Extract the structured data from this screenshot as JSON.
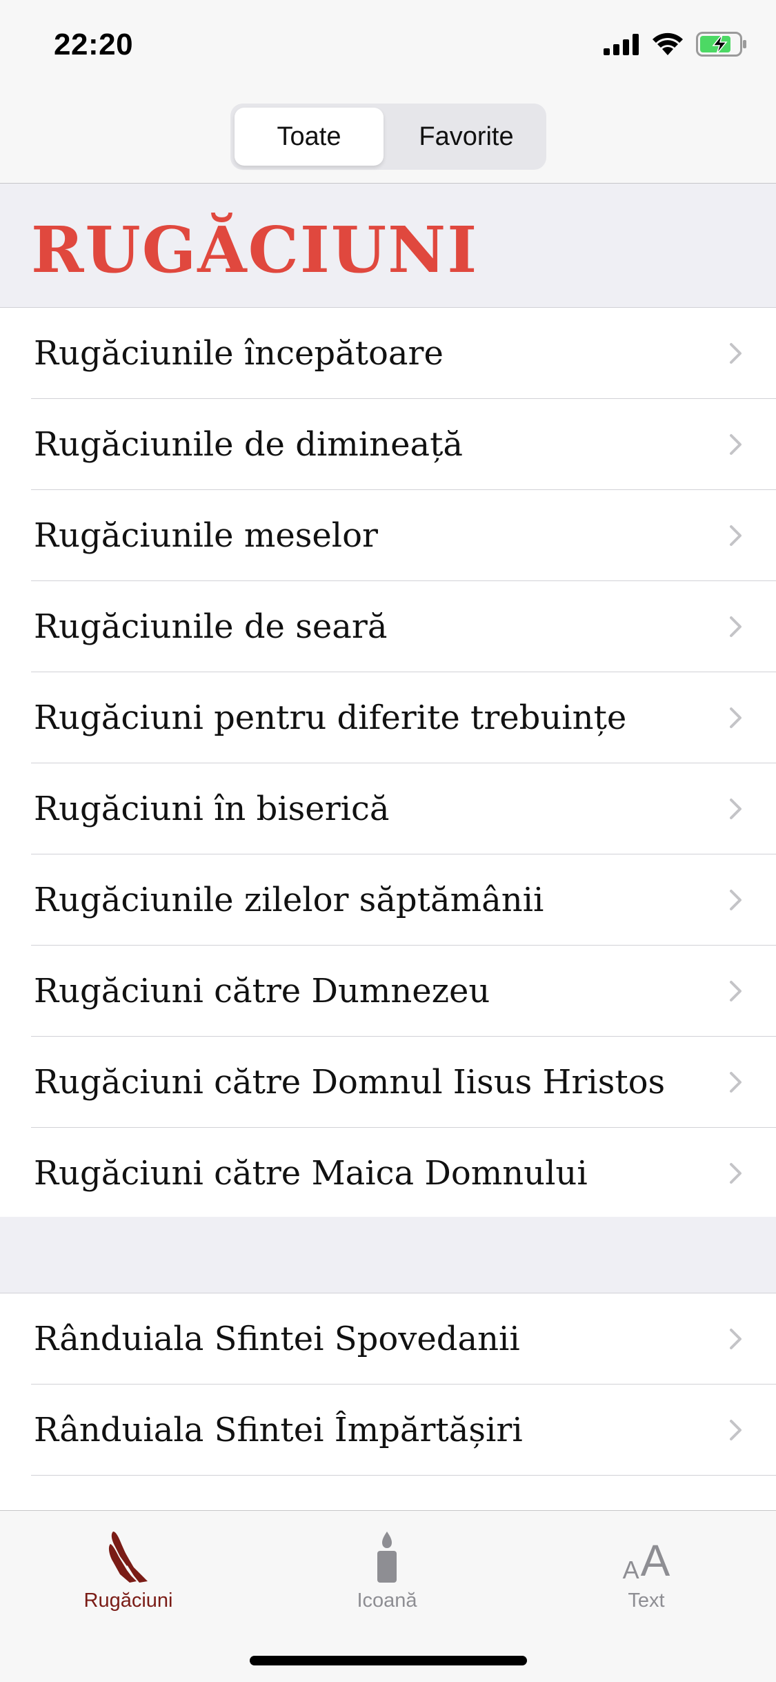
{
  "status_bar": {
    "time": "22:20",
    "icons": [
      "cellular-signal-icon",
      "wifi-icon",
      "battery-charging-icon"
    ]
  },
  "segmented_control": {
    "options": [
      "Toate",
      "Favorite"
    ],
    "selected": "Toate"
  },
  "section": {
    "title": "RUGĂCIUNI"
  },
  "list_primary": [
    {
      "label": "Rugăciunile începătoare"
    },
    {
      "label": "Rugăciunile de dimineață"
    },
    {
      "label": "Rugăciunile meselor"
    },
    {
      "label": "Rugăciunile de seară"
    },
    {
      "label": "Rugăciuni pentru diferite trebuințe"
    },
    {
      "label": "Rugăciuni în biserică"
    },
    {
      "label": "Rugăciunile zilelor săptămânii"
    },
    {
      "label": "Rugăciuni către Dumnezeu"
    },
    {
      "label": "Rugăciuni către Domnul Iisus Hristos"
    },
    {
      "label": "Rugăciuni către Maica Domnului"
    }
  ],
  "list_secondary": [
    {
      "label": "Rânduiala Sfintei Spovedanii"
    },
    {
      "label": "Rânduiala Sfintei Împărtășiri"
    }
  ],
  "tab_bar": {
    "tabs": [
      {
        "label": "Rugăciuni",
        "icon": "praying-hands-icon",
        "active": true
      },
      {
        "label": "Icoană",
        "icon": "candle-icon",
        "active": false
      },
      {
        "label": "Text",
        "icon": "text-size-icon",
        "active": false
      }
    ],
    "text_icon_small": "A",
    "text_icon_large": "A"
  },
  "colors": {
    "accent_red": "#e0483e",
    "active_tab": "#7a1c16",
    "inactive_tab": "#8e8e93",
    "battery_green": "#4cd964"
  }
}
